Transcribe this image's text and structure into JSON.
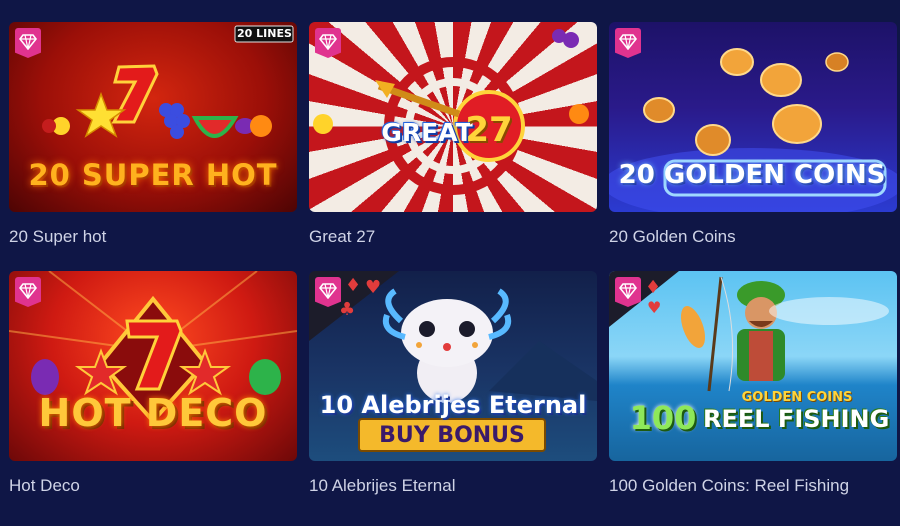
{
  "games": [
    {
      "title": "20 Super hot",
      "logo_text": "20 SUPER HOT",
      "lines_badge": "20 LINES",
      "logo_number": "7",
      "colors": {
        "bg_top": "#b0140c",
        "bg_bottom": "#5a0505",
        "logo": "#ffb21e"
      }
    },
    {
      "title": "Great 27",
      "logo_text": "GREAT",
      "logo_number": "27",
      "colors": {
        "board_red": "#c4161c",
        "board_white": "#f3ece4",
        "logo": "#2a6ee8"
      }
    },
    {
      "title": "20 Golden Coins",
      "logo_text": "20 GOLDEN COINS",
      "colors": {
        "bg_top": "#1d1268",
        "bg_bottom": "#2b3bd1",
        "coin": "#f2a43a"
      }
    },
    {
      "title": "Hot Deco",
      "logo_text": "HOT DECO",
      "logo_number": "7",
      "colors": {
        "bg_top": "#e0271c",
        "bg_bottom": "#6d0808",
        "logo": "#ffc83a"
      }
    },
    {
      "title": "10 Alebrijes Eternal",
      "logo_text": "10 Alebrijes Eternal",
      "sub_text": "BUY BONUS",
      "colors": {
        "bg_top": "#12204a",
        "bg_bottom": "#1d4d7d",
        "banner": "#f4b92b"
      }
    },
    {
      "title": "100 Golden Coins: Reel Fishing",
      "logo_text": "REEL FISHING",
      "logo_number": "100",
      "logo_sub": "GOLDEN COINS",
      "colors": {
        "sky": "#5cc3f2",
        "water": "#1f84c9",
        "logo": "#7fe05a"
      }
    }
  ],
  "badge_icon": "diamond-icon",
  "page_background": "#0f1646"
}
